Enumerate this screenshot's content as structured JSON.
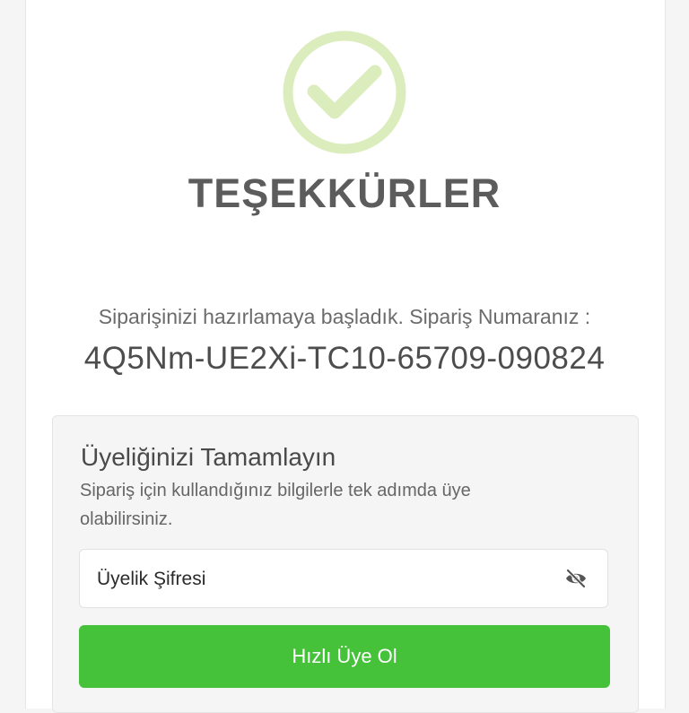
{
  "success": {
    "icon": "check-circle-icon",
    "icon_color": "#dcedbd",
    "title": "TEŞEKKÜRLER"
  },
  "order": {
    "info_text": "Siparişinizi hazırlamaya başladık. Sipariş Numaranız :",
    "number": "4Q5Nm-UE2Xi-TC10-65709-090824"
  },
  "membership": {
    "title": "Üyeliğinizi Tamamlayın",
    "description": "Sipariş için kullandığınız bilgilerle tek adımda üye olabilirsiniz.",
    "password_label": "Üyelik Şifresi",
    "password_icon": "eye-off-icon",
    "button_label": "Hızlı Üye Ol",
    "button_color": "#46c23a"
  }
}
